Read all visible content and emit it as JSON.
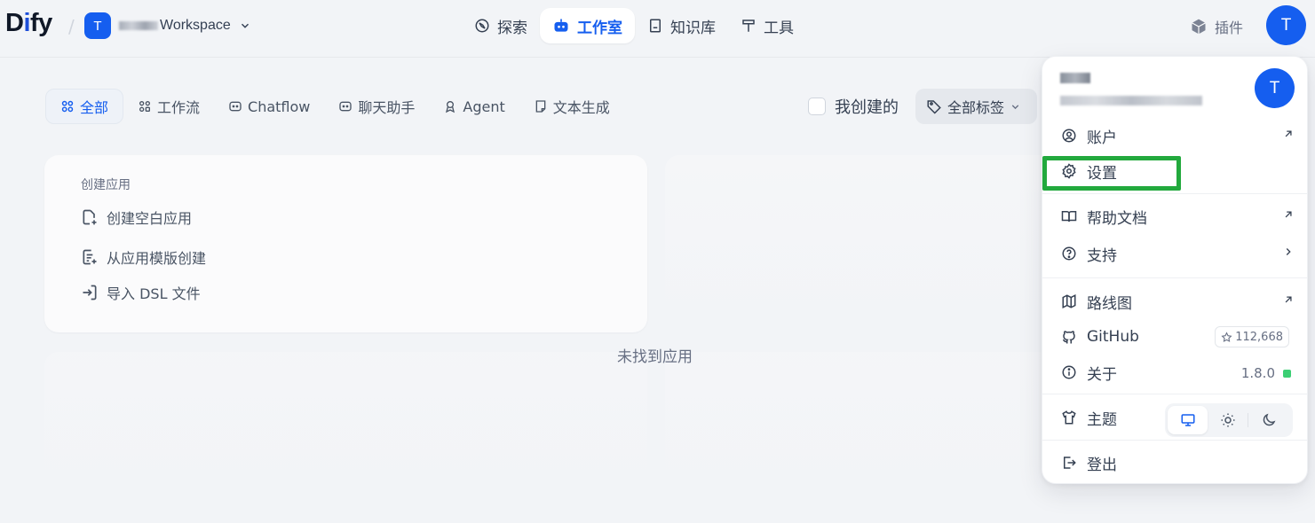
{
  "header": {
    "logo_prefix": "D",
    "logo_accent": "i",
    "logo_suffix": "fy",
    "separator": "/",
    "workspace_initial": "T",
    "workspace_name": "Workspace",
    "nav": [
      {
        "label": "探索",
        "icon": "compass-icon"
      },
      {
        "label": "工作室",
        "icon": "robot-icon",
        "active": true
      },
      {
        "label": "知识库",
        "icon": "book-icon"
      },
      {
        "label": "工具",
        "icon": "hammer-icon"
      }
    ],
    "plugins_label": "插件",
    "user_initial": "T"
  },
  "filters": {
    "items": [
      {
        "label": "全部",
        "icon": "grid-icon",
        "active": true
      },
      {
        "label": "工作流",
        "icon": "workflow-icon"
      },
      {
        "label": "Chatflow",
        "icon": "chatflow-icon"
      },
      {
        "label": "聊天助手",
        "icon": "chat-bot-icon"
      },
      {
        "label": "Agent",
        "icon": "agent-icon"
      },
      {
        "label": "文本生成",
        "icon": "document-icon"
      }
    ],
    "mine_label": "我创建的",
    "mine_checked": false,
    "tags_label": "全部标签"
  },
  "create_card": {
    "title": "创建应用",
    "items": [
      {
        "label": "创建空白应用",
        "icon": "new-file-icon"
      },
      {
        "label": "从应用模版创建",
        "icon": "template-file-icon"
      },
      {
        "label": "导入 DSL 文件",
        "icon": "import-icon"
      }
    ]
  },
  "empty_text": "未找到应用",
  "user_menu": {
    "avatar_initial": "T",
    "items": {
      "account": "账户",
      "settings": "设置",
      "help": "帮助文档",
      "support": "支持",
      "roadmap": "路线图",
      "github": "GitHub",
      "github_stars": "112,668",
      "about": "关于",
      "version": "1.8.0",
      "theme": "主题",
      "logout": "登出"
    },
    "theme_selected": "system",
    "colors": {
      "accent": "#155eef",
      "highlight": "#22a93d",
      "status": "#3ccf74"
    }
  }
}
